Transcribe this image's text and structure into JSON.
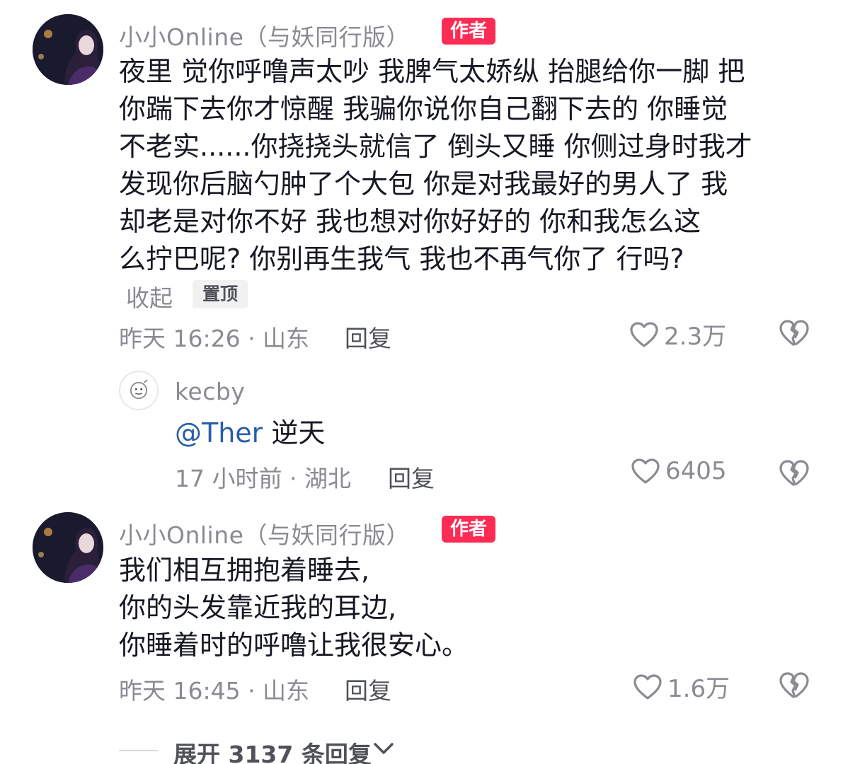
{
  "comments": [
    {
      "author": "小小Online（与妖同行版）",
      "badge": "作者",
      "lines": [
        "夜里 觉你呼噜声太吵 我脾气太娇纵 抬腿给你一脚 把",
        "你踹下去你才惊醒 我骗你说你自己翻下去的 你睡觉",
        "不老实......你挠挠头就信了 倒头又睡 你侧过身时我才",
        "发现你后脑勺肿了个大包 你是对我最好的男人了 我",
        "却老是对你不好 我也想对你好好的   你和我怎么这",
        "么拧巴呢? 你别再生我气 我也不再气你了 行吗?"
      ],
      "collapse_label": "收起",
      "pin_label": "置顶",
      "meta": "昨天 16:26 · 山东",
      "reply_label": "回复",
      "like_count": "2.3万"
    },
    {
      "author": "kecby",
      "mention": "@Ther",
      "text": "逆天",
      "meta": "17 小时前 · 湖北",
      "reply_label": "回复",
      "like_count": "6405"
    },
    {
      "author": "小小Online（与妖同行版）",
      "badge": "作者",
      "lines": [
        "我们相互拥抱着睡去,",
        "你的头发靠近我的耳边,",
        "你睡着时的呼噜让我很安心。"
      ],
      "meta": "昨天 16:45 · 山东",
      "reply_label": "回复",
      "like_count": "1.6万"
    }
  ],
  "expand_label": "展开 3137 条回复",
  "icons": {
    "like": "heart-outline-icon",
    "dislike": "broken-heart-icon",
    "expand": "chevron-down-icon"
  },
  "colors": {
    "badge": "#fe2c55",
    "mention": "#2a5ea6",
    "meta": "#8a8b91",
    "text": "#161823"
  }
}
